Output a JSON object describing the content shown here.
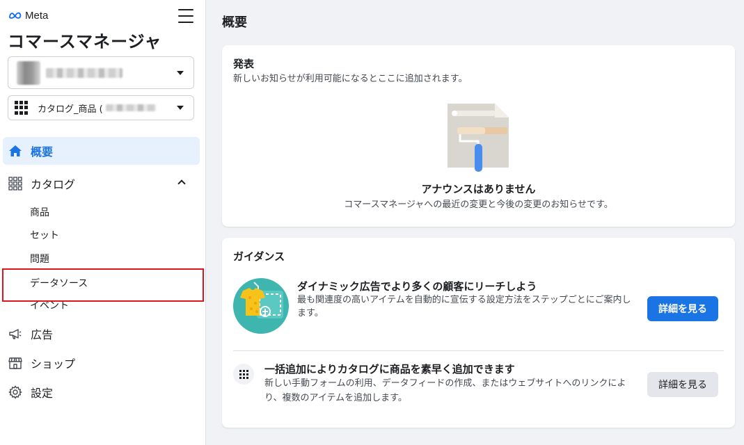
{
  "sidebar": {
    "brand": "Meta",
    "app_title": "コマースマネージャ",
    "catalog_select": {
      "label": "カタログ_商品 ("
    },
    "nav": {
      "overview": "概要",
      "catalog": "カタログ",
      "catalog_items": [
        "商品",
        "セット",
        "問題",
        "データソース",
        "イベント"
      ],
      "ads": "広告",
      "shop": "ショップ",
      "settings": "設定"
    }
  },
  "main": {
    "page_title": "概要",
    "announcements": {
      "title": "発表",
      "subtitle": "新しいお知らせが利用可能になるとここに追加されます。",
      "empty_title": "アナウンスはありません",
      "empty_sub": "コマースマネージャへの最近の変更と今後の変更のお知らせです。"
    },
    "guidance": {
      "title": "ガイダンス",
      "items": [
        {
          "title": "ダイナミック広告でより多くの顧客にリーチしよう",
          "desc": "最も関連度の高いアイテムを自動的に宣伝する設定方法をステップごとにご案内します。",
          "button": "詳細を見る"
        },
        {
          "title": "一括追加によりカタログに商品を素早く追加できます",
          "desc": "新しい手動フォームの利用、データフィードの作成、またはウェブサイトへのリンクにより、複数のアイテムを追加します。",
          "button": "詳細を見る"
        }
      ]
    }
  },
  "colors": {
    "accent": "#1b74e4",
    "active_bg": "#e7f0fd",
    "highlight": "#e0141e",
    "teal": "#3fb5b0"
  }
}
